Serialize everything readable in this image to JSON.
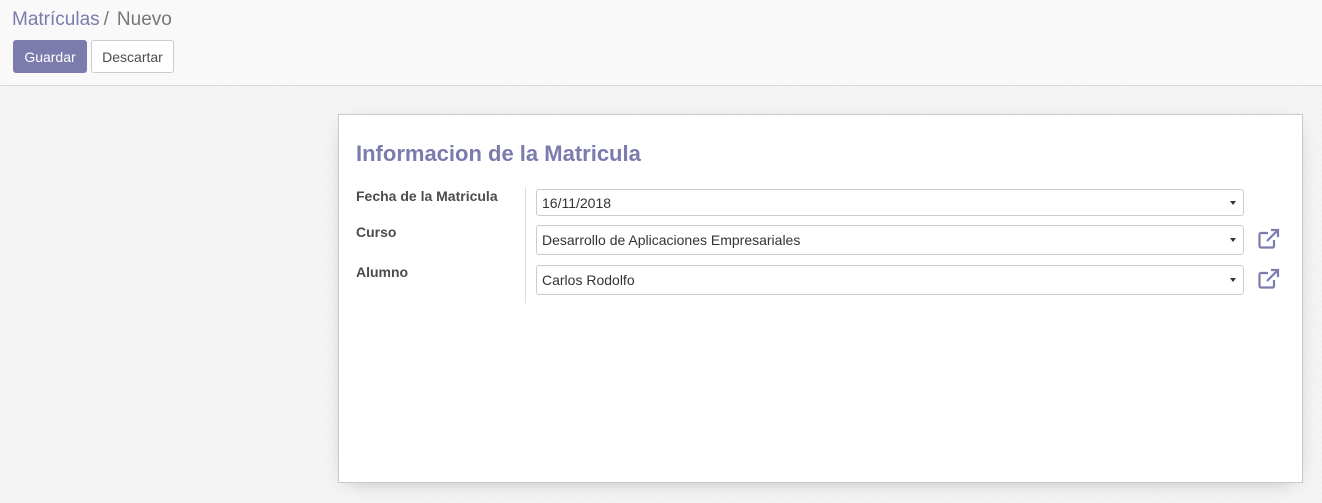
{
  "breadcrumb": {
    "parent": "Matrículas",
    "separator": "/",
    "current": "Nuevo"
  },
  "buttons": {
    "save": "Guardar",
    "discard": "Descartar"
  },
  "form": {
    "title": "Informacion de la Matricula",
    "fields": {
      "fecha": {
        "label": "Fecha de la Matricula",
        "value": "16/11/2018"
      },
      "curso": {
        "label": "Curso",
        "value": "Desarrollo de Aplicaciones Empresariales",
        "icon": "external-link-icon"
      },
      "alumno": {
        "label": "Alumno",
        "value": "Carlos Rodolfo",
        "icon": "external-link-icon"
      }
    }
  },
  "colors": {
    "accent": "#7c7bad",
    "text": "#4c4c4c",
    "border": "#cccccc",
    "background": "#f5f5f5"
  }
}
